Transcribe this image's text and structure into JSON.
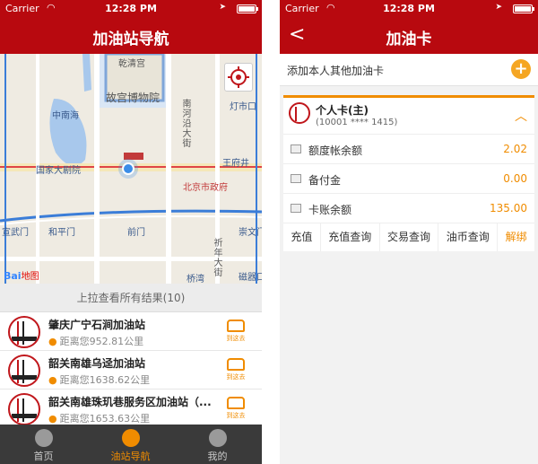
{
  "status_bar": {
    "carrier": "Carrier",
    "time": "12:28 PM"
  },
  "left": {
    "title": "加油站导航",
    "map": {
      "labels": {
        "qianqing_palace": "乾清宫",
        "palace_museum": "故宫博物院",
        "zhongnanhai": "中南海",
        "nanheyan": "南河沿大街",
        "dengshikou": "灯市口",
        "wangfujing": "王府井",
        "national_theater": "国家大剧院",
        "beijing_gov": "北京市政府",
        "hepingmen": "和平门",
        "qianmen": "前门",
        "chongwenmen": "崇文门",
        "wumen": "宣武门",
        "qiannian": "祈年大街",
        "ciqikou": "磁器口",
        "qiaowan": "桥湾"
      },
      "baidu_logo_main": "Bai",
      "baidu_logo_sub": "地图"
    },
    "pull_up_text": "上拉查看所有结果(10)",
    "stations": [
      {
        "name": "肇庆广宁石涧加油站",
        "distance": "距离您952.81公里",
        "goto_label": "到这去"
      },
      {
        "name": "韶关南雄乌迳加油站",
        "distance": "距离您1638.62公里",
        "goto_label": "到这去"
      },
      {
        "name": "韶关南雄珠玑巷服务区加油站（...",
        "distance": "距离您1653.63公里",
        "goto_label": "到这去"
      }
    ],
    "tabs": [
      {
        "label": "首页",
        "icon": "home-icon"
      },
      {
        "label": "油站导航",
        "icon": "compass-icon"
      },
      {
        "label": "我的",
        "icon": "user-icon"
      }
    ]
  },
  "right": {
    "title": "加油卡",
    "back_glyph": "<",
    "add_card_text": "添加本人其他加油卡",
    "card": {
      "name": "个人卡(主)",
      "number": "(10001 **** 1415)",
      "rows": [
        {
          "label": "额度帐余额",
          "value": "2.02"
        },
        {
          "label": "备付金",
          "value": "0.00"
        },
        {
          "label": "卡账余额",
          "value": "135.00"
        }
      ],
      "actions": [
        "充值",
        "充值查询",
        "交易查询",
        "油币查询",
        "解绑"
      ]
    }
  },
  "colors": {
    "brand_red": "#b8090f",
    "accent_orange": "#f08c00"
  }
}
